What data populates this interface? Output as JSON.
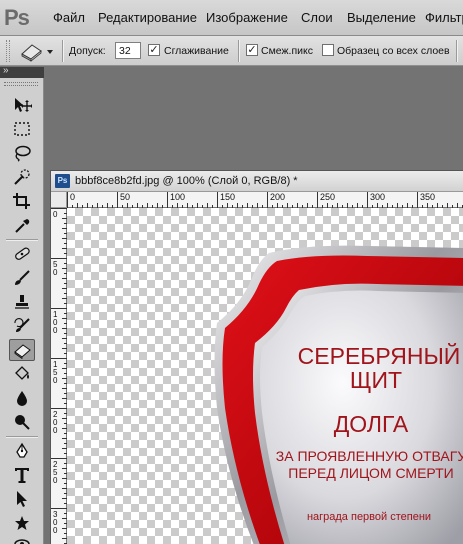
{
  "app": {
    "logo_text": "Ps",
    "menu": [
      "Файл",
      "Редактирование",
      "Изображение",
      "Слои",
      "Выделение",
      "Фильтр"
    ]
  },
  "options_bar": {
    "tolerance_label": "Допуск:",
    "tolerance_value": "32",
    "antialias_label": "Сглаживание",
    "antialias_checked": true,
    "contiguous_label": "Смеж.пикс",
    "contiguous_checked": true,
    "all_layers_label": "Образец со всех слоев",
    "all_layers_checked": false
  },
  "toolbox": {
    "collapse_glyph": "»",
    "tools": [
      {
        "name": "move-tool-icon",
        "active": false
      },
      {
        "name": "marquee-tool-icon",
        "active": false
      },
      {
        "name": "lasso-tool-icon",
        "active": false
      },
      {
        "name": "quick-selection-tool-icon",
        "active": false
      },
      {
        "name": "crop-tool-icon",
        "active": false
      },
      {
        "name": "eyedropper-tool-icon",
        "active": false
      },
      {
        "name": "healing-brush-tool-icon",
        "active": false
      },
      {
        "name": "brush-tool-icon",
        "active": false
      },
      {
        "name": "clone-stamp-tool-icon",
        "active": false
      },
      {
        "name": "history-brush-tool-icon",
        "active": false
      },
      {
        "name": "eraser-tool-icon",
        "active": true
      },
      {
        "name": "paint-bucket-tool-icon",
        "active": false
      },
      {
        "name": "blur-tool-icon",
        "active": false
      },
      {
        "name": "dodge-tool-icon",
        "active": false
      },
      {
        "name": "pen-tool-icon",
        "active": false
      },
      {
        "name": "type-tool-icon",
        "active": false
      },
      {
        "name": "path-selection-tool-icon",
        "active": false
      },
      {
        "name": "custom-shape-tool-icon",
        "active": false
      },
      {
        "name": "3d-rotate-tool-icon",
        "active": false
      }
    ]
  },
  "document": {
    "ps_icon_text": "Ps",
    "title": "bbbf8ce8b2fd.jpg @ 100% (Слой 0, RGB/8) *",
    "ruler_h_labels": [
      "0",
      "50",
      "100",
      "150",
      "200",
      "250",
      "300",
      "350"
    ],
    "ruler_v_labels": [
      "0",
      "5 0",
      "1 0 0",
      "1 5 0",
      "2 0 0",
      "2 5 0",
      "3 0 0"
    ]
  },
  "artwork": {
    "line1": "СЕРЕБРЯНЫЙ",
    "line2": "ЩИТ",
    "line3": "ДОЛГА",
    "line4": "ЗА ПРОЯВЛЕННУЮ ОТВАГУ",
    "line5": "ПЕРЕД ЛИЦОМ СМЕРТИ",
    "line6": "награда первой степени",
    "colors": {
      "red": "#c8090f",
      "silver": "#d7d7da",
      "text": "#a0141b"
    }
  }
}
